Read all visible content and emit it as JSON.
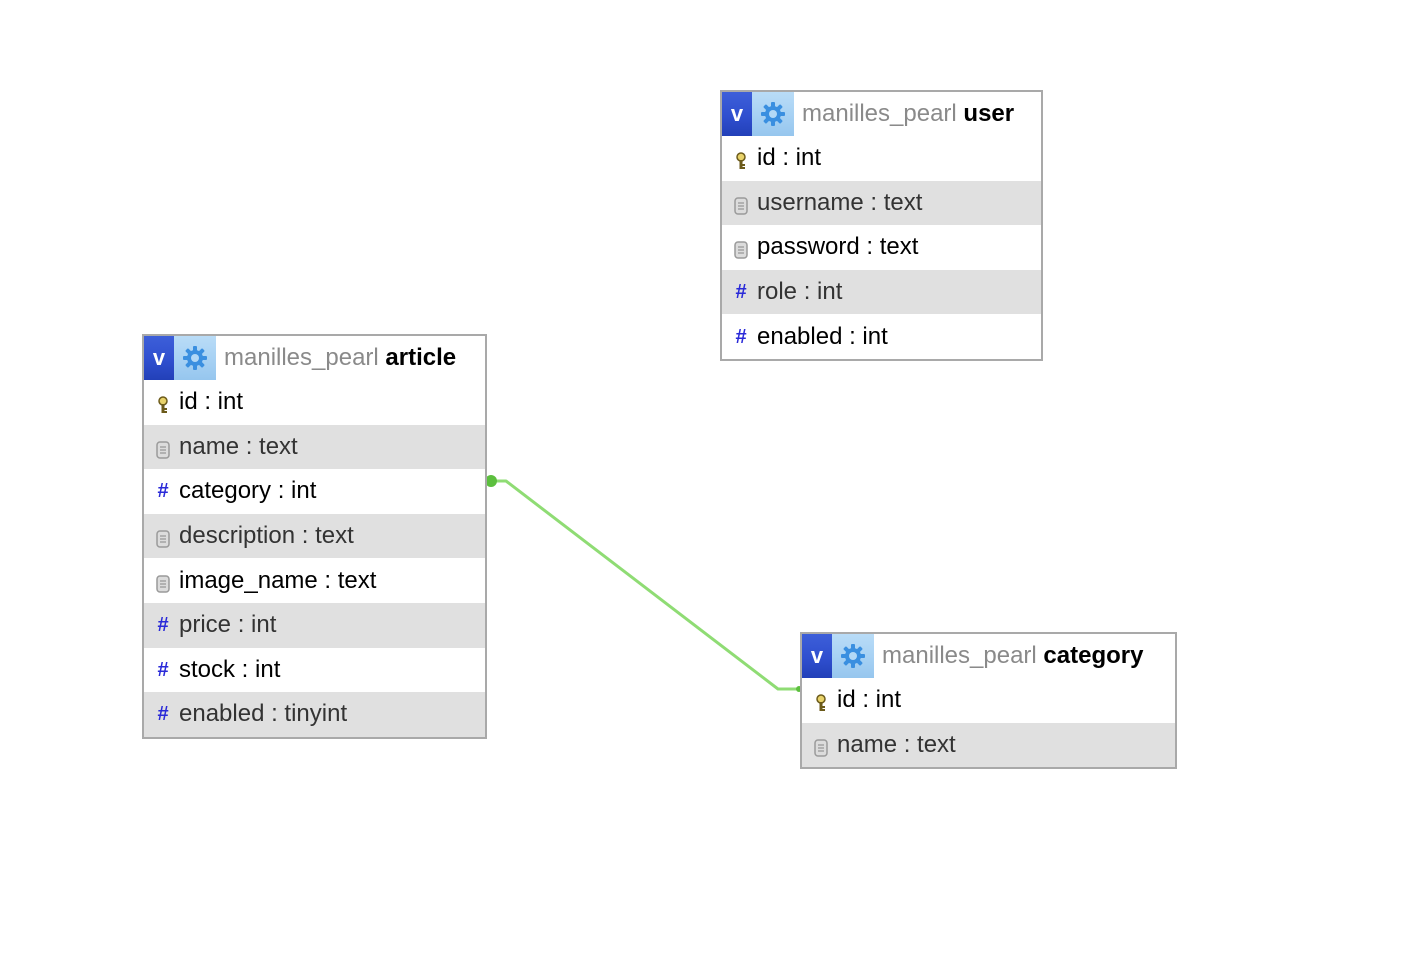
{
  "tables": {
    "article": {
      "db": "manilles_pearl",
      "name": "article",
      "columns": [
        {
          "label": "id : int",
          "icon": "primary-key-icon"
        },
        {
          "label": "name : text",
          "icon": "text-field-icon"
        },
        {
          "label": "category : int",
          "icon": "numeric-field-icon"
        },
        {
          "label": "description : text",
          "icon": "text-field-icon"
        },
        {
          "label": "image_name : text",
          "icon": "text-field-icon"
        },
        {
          "label": "price : int",
          "icon": "numeric-field-icon"
        },
        {
          "label": "stock : int",
          "icon": "numeric-field-icon"
        },
        {
          "label": "enabled : tinyint",
          "icon": "numeric-field-icon"
        }
      ]
    },
    "user": {
      "db": "manilles_pearl",
      "name": "user",
      "columns": [
        {
          "label": "id : int",
          "icon": "primary-key-icon"
        },
        {
          "label": "username : text",
          "icon": "text-field-icon"
        },
        {
          "label": "password : text",
          "icon": "text-field-icon"
        },
        {
          "label": "role : int",
          "icon": "numeric-field-icon"
        },
        {
          "label": "enabled : int",
          "icon": "numeric-field-icon"
        }
      ]
    },
    "category": {
      "db": "manilles_pearl",
      "name": "category",
      "columns": [
        {
          "label": "id : int",
          "icon": "primary-key-icon"
        },
        {
          "label": "name : text",
          "icon": "text-field-icon"
        }
      ]
    }
  },
  "toggle_button_label": "v",
  "relation_color": "#8fdc74",
  "relation_endpoint_color": "#5cbf3e"
}
